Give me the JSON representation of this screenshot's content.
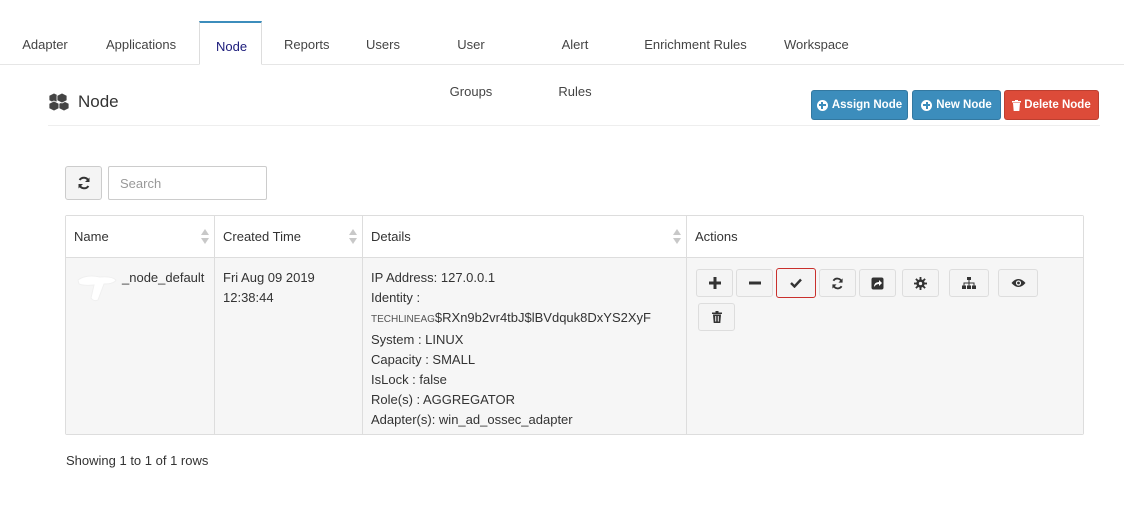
{
  "tabs": [
    {
      "label": "Adapter",
      "active": false
    },
    {
      "label": "Applications",
      "active": false
    },
    {
      "label": "Node",
      "active": true
    },
    {
      "label": "Reports",
      "active": false
    },
    {
      "label": "Users",
      "active": false
    },
    {
      "label": "User Groups",
      "active": false
    },
    {
      "label": "Alert Rules",
      "active": false
    },
    {
      "label": "Enrichment Rules",
      "active": false
    },
    {
      "label": "Workspace",
      "active": false
    }
  ],
  "page": {
    "title": "Node",
    "title_icon": "cubes-icon"
  },
  "actions": {
    "assign_label": "Assign Node",
    "new_label": "New Node",
    "delete_label": "Delete Node"
  },
  "colors": {
    "primary": "#3c8dbc",
    "danger": "#dd4b39",
    "active_tab_text": "#1a1a7a"
  },
  "toolbar": {
    "search_placeholder": "Search"
  },
  "table": {
    "columns": [
      "Name",
      "Created Time",
      "Details",
      "Actions"
    ],
    "rows": [
      {
        "name": "_node_default",
        "created_date": "Fri Aug 09 2019",
        "created_time": "12:38:44",
        "details": {
          "ip": "IP Address: 127.0.0.1",
          "identity_label": "Identity :",
          "identity_prefix": "TECHLINEAG",
          "identity_value": "$RXn9b2vr4tbJ$lBVdquk8DxYS2XyF",
          "system": "System : LINUX",
          "capacity": "Capacity : SMALL",
          "islock": "IsLock : false",
          "roles": "Role(s) : AGGREGATOR",
          "adapters": "Adapter(s): win_ad_ossec_adapter"
        },
        "action_icons": [
          "plus-icon",
          "minus-icon",
          "check-icon",
          "refresh-icon",
          "share-square-icon",
          "gear-icon",
          "sitemap-icon",
          "eye-icon",
          "trash-icon"
        ]
      }
    ]
  },
  "pagination": {
    "summary": "Showing 1 to 1 of 1 rows"
  }
}
